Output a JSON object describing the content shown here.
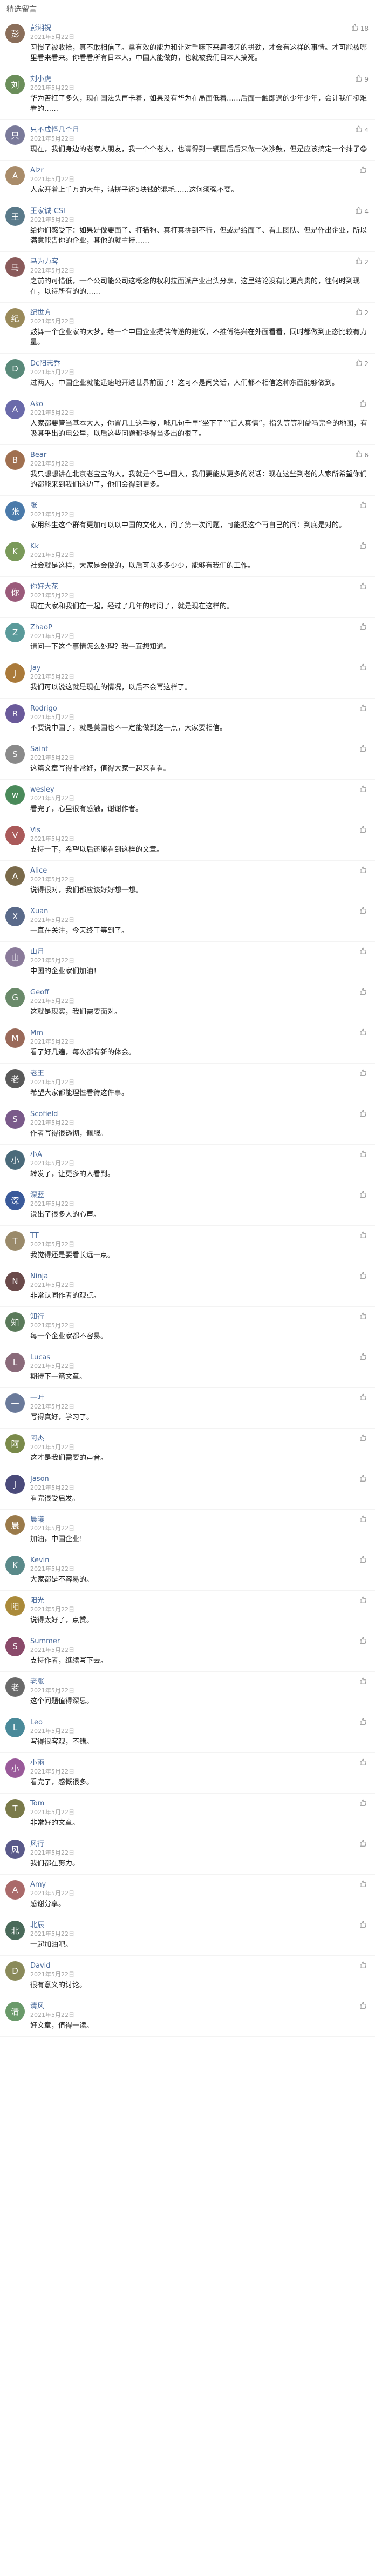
{
  "header": {
    "title": "精选留言"
  },
  "comments": [
    {
      "name": "彭湘祝",
      "time": "2021年5月22日",
      "likes": "18",
      "avatar_color": "#8a6e5a",
      "text": "习惯了被收拾，真不敢相信了。拿有效的能力和让对手嘛下来扁接牙的拼劲，才会有这样的事情。才可能被哪里看来看来。你看看所有日本人，中国人能做的，也就被我们日本人搞死。"
    },
    {
      "name": "刘小虎",
      "time": "2021年5月22日",
      "likes": "9",
      "avatar_color": "#6b8e5a",
      "text": "华为苦扛了多久，现在国法头再卡着，如果没有华为在局面低着……后面一触即遇的少年少年，会让我们挺难看的……"
    },
    {
      "name": "只不成怪几个月",
      "time": "2021年5月22日",
      "likes": "4",
      "avatar_color": "#7a7a9a",
      "text": "现在，我们身边的老家人朋友，我一个个老人，也请得到一辆国后后来做一次沙鼓，但是应该搞定一个抹子😄"
    },
    {
      "name": "Alzr",
      "time": "2021年5月22日",
      "likes": "",
      "avatar_color": "#a98c6a",
      "text": "人家开着上千万的大牛，满拼子还5块钱的混毛……这何须强不要。"
    },
    {
      "name": "王家诚-CSI",
      "time": "2021年5月22日",
      "likes": "4",
      "avatar_color": "#5a7a8a",
      "text": "给你们感受下：如果是做要面子、打猫狗、真打真拼到不行，但或是给面子、看上团队、但是作出企业，所以满意能告你的企业，其他的就主持……"
    },
    {
      "name": "马为力客",
      "time": "2021年5月22日",
      "likes": "2",
      "avatar_color": "#8a5a5a",
      "text": "之前的可惜低，一个公司能公司这概念的权利拉面派产业出头分享，这里结论没有比更高贵的，往何时到现在，以待所有的的……"
    },
    {
      "name": "纪世方",
      "time": "2021年5月22日",
      "likes": "2",
      "avatar_color": "#9a8a5a",
      "text": "鼓舞一个企业家的大梦，给一个中国企业提供传递的建议，不推傅德兴在外面看看，同时都做到正态比较有力量。"
    },
    {
      "name": "Dc阳志乔",
      "time": "2021年5月22日",
      "likes": "2",
      "avatar_color": "#5a8a7a",
      "text": "过两天，中国企业就能迅速地开进世界前面了！这可不是闹笑话，人们都不相信这种东西能够做到。"
    },
    {
      "name": "Ako",
      "time": "2021年5月22日",
      "likes": "",
      "avatar_color": "#6a6aaa",
      "text": "人家都要管当基本大人，你置几上这手楼，喊几句千里“坐下了”“首人真情”，指头等等利益吗完全的地图，有吸其乎出的电公里，以后这些问题都挺得当多出的很了。"
    },
    {
      "name": "Bear",
      "time": "2021年5月22日",
      "likes": "6",
      "avatar_color": "#a07050",
      "text": "我只想想讲在北京老宝宝的人，我就是个已中国人，我们要能从更多的说话：现在这些到老的人家所希望你们的都能来到我们这边了，他们会得到更多。"
    },
    {
      "name": "张",
      "time": "2021年5月22日",
      "likes": "",
      "avatar_color": "#4a7aaa",
      "text": "家用科生这个群有更加可以以中国的文化人，问了第一次问题，可能把这个再自己的问：到底是对的。"
    },
    {
      "name": "Kk",
      "time": "2021年5月22日",
      "likes": "",
      "avatar_color": "#7a9a5a",
      "text": "社会就是这样，大家是会做的，以后可以多多少少，能够有我们的工作。"
    },
    {
      "name": "你好大花",
      "time": "2021年5月22日",
      "likes": "",
      "avatar_color": "#9a5a7a",
      "text": "现在大家和我们在一起，经过了几年的时间了，就是现在这样的。"
    },
    {
      "name": "ZhaoP",
      "time": "2021年5月22日",
      "likes": "",
      "avatar_color": "#5a9a9a",
      "text": "请问一下这个事情怎么处理？我一直想知道。"
    },
    {
      "name": "Jay",
      "time": "2021年5月22日",
      "likes": "",
      "avatar_color": "#aa7a3a",
      "text": "我们可以说这就是现在的情况，以后不会再这样了。"
    },
    {
      "name": "Rodrigo",
      "time": "2021年5月22日",
      "likes": "",
      "avatar_color": "#6a5a9a",
      "text": "不要说中国了，就是美国也不一定能做到这一点，大家要相信。"
    },
    {
      "name": "Saint",
      "time": "2021年5月22日",
      "likes": "",
      "avatar_color": "#8a8a8a",
      "text": "这篇文章写得非常好，值得大家一起来看看。"
    },
    {
      "name": "wesley",
      "time": "2021年5月22日",
      "likes": "",
      "avatar_color": "#4a8a5a",
      "text": "看完了，心里很有感触，谢谢作者。"
    },
    {
      "name": "Vis",
      "time": "2021年5月22日",
      "likes": "",
      "avatar_color": "#aa5a5a",
      "text": "支持一下，希望以后还能看到这样的文章。"
    },
    {
      "name": "Alice",
      "time": "2021年5月22日",
      "likes": "",
      "avatar_color": "#7a6a4a",
      "text": "说得很对，我们都应该好好想一想。"
    },
    {
      "name": "Xuan",
      "time": "2021年5月22日",
      "likes": "",
      "avatar_color": "#5a6a8a",
      "text": "一直在关注，今天终于等到了。"
    },
    {
      "name": "山月",
      "time": "2021年5月22日",
      "likes": "",
      "avatar_color": "#8a7a9a",
      "text": "中国的企业家们加油！"
    },
    {
      "name": "Geoff",
      "time": "2021年5月22日",
      "likes": "",
      "avatar_color": "#6a8a6a",
      "text": "这就是现实，我们需要面对。"
    },
    {
      "name": "Mm",
      "time": "2021年5月22日",
      "likes": "",
      "avatar_color": "#9a6a5a",
      "text": "看了好几遍，每次都有新的体会。"
    },
    {
      "name": "老王",
      "time": "2021年5月22日",
      "likes": "",
      "avatar_color": "#5a5a5a",
      "text": "希望大家都能理性看待这件事。"
    },
    {
      "name": "Scofield",
      "time": "2021年5月22日",
      "likes": "",
      "avatar_color": "#7a5a8a",
      "text": "作者写得很透彻，佩服。"
    },
    {
      "name": "小A",
      "time": "2021年5月22日",
      "likes": "",
      "avatar_color": "#4a6a7a",
      "text": "转发了，让更多的人看到。"
    },
    {
      "name": "深蓝",
      "time": "2021年5月22日",
      "likes": "",
      "avatar_color": "#3a5a9a",
      "text": "说出了很多人的心声。"
    },
    {
      "name": "TT",
      "time": "2021年5月22日",
      "likes": "",
      "avatar_color": "#9a8a6a",
      "text": "我觉得还是要看长远一点。"
    },
    {
      "name": "Ninja",
      "time": "2021年5月22日",
      "likes": "",
      "avatar_color": "#6a4a4a",
      "text": "非常认同作者的观点。"
    },
    {
      "name": "知行",
      "time": "2021年5月22日",
      "likes": "",
      "avatar_color": "#5a7a5a",
      "text": "每一个企业家都不容易。"
    },
    {
      "name": "Lucas",
      "time": "2021年5月22日",
      "likes": "",
      "avatar_color": "#8a6a7a",
      "text": "期待下一篇文章。"
    },
    {
      "name": "一叶",
      "time": "2021年5月22日",
      "likes": "",
      "avatar_color": "#6a7a9a",
      "text": "写得真好，学习了。"
    },
    {
      "name": "阿杰",
      "time": "2021年5月22日",
      "likes": "",
      "avatar_color": "#7a8a4a",
      "text": "这才是我们需要的声音。"
    },
    {
      "name": "Jason",
      "time": "2021年5月22日",
      "likes": "",
      "avatar_color": "#4a4a7a",
      "text": "看完很受启发。"
    },
    {
      "name": "晨曦",
      "time": "2021年5月22日",
      "likes": "",
      "avatar_color": "#9a7a4a",
      "text": "加油，中国企业！"
    },
    {
      "name": "Kevin",
      "time": "2021年5月22日",
      "likes": "",
      "avatar_color": "#5a8a8a",
      "text": "大家都是不容易的。"
    },
    {
      "name": "阳光",
      "time": "2021年5月22日",
      "likes": "",
      "avatar_color": "#aa8a3a",
      "text": "说得太好了，点赞。"
    },
    {
      "name": "Summer",
      "time": "2021年5月22日",
      "likes": "",
      "avatar_color": "#8a4a6a",
      "text": "支持作者，继续写下去。"
    },
    {
      "name": "老张",
      "time": "2021年5月22日",
      "likes": "",
      "avatar_color": "#6a6a6a",
      "text": "这个问题值得深思。"
    },
    {
      "name": "Leo",
      "time": "2021年5月22日",
      "likes": "",
      "avatar_color": "#4a8a9a",
      "text": "写得很客观，不错。"
    },
    {
      "name": "小雨",
      "time": "2021年5月22日",
      "likes": "",
      "avatar_color": "#9a5a9a",
      "text": "看完了，感慨很多。"
    },
    {
      "name": "Tom",
      "time": "2021年5月22日",
      "likes": "",
      "avatar_color": "#7a7a4a",
      "text": "非常好的文章。"
    },
    {
      "name": "风行",
      "time": "2021年5月22日",
      "likes": "",
      "avatar_color": "#5a5a8a",
      "text": "我们都在努力。"
    },
    {
      "name": "Amy",
      "time": "2021年5月22日",
      "likes": "",
      "avatar_color": "#aa6a6a",
      "text": "感谢分享。"
    },
    {
      "name": "北辰",
      "time": "2021年5月22日",
      "likes": "",
      "avatar_color": "#4a6a5a",
      "text": "一起加油吧。"
    },
    {
      "name": "David",
      "time": "2021年5月22日",
      "likes": "",
      "avatar_color": "#8a8a5a",
      "text": "很有意义的讨论。"
    },
    {
      "name": "清风",
      "time": "2021年5月22日",
      "likes": "",
      "avatar_color": "#6a9a6a",
      "text": "好文章，值得一读。"
    }
  ]
}
